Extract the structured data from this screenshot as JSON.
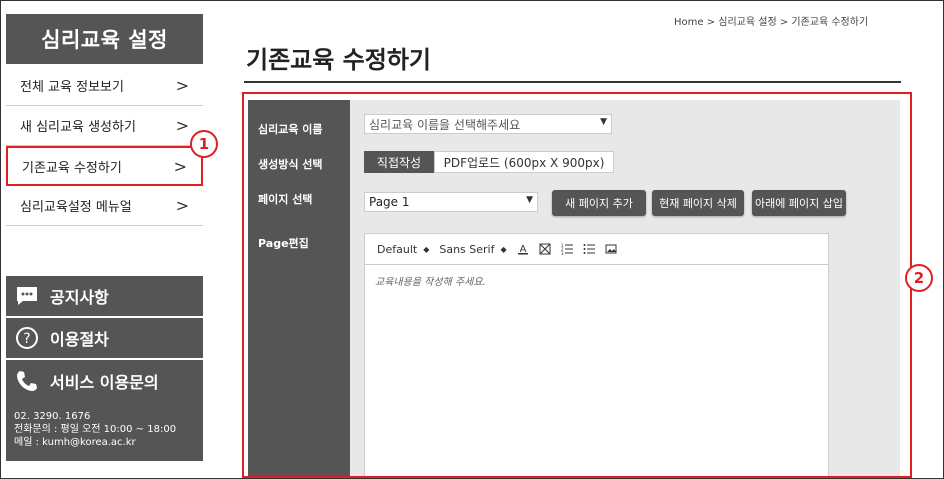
{
  "sidebar": {
    "title": "심리교육 설정",
    "items": [
      {
        "label": "전체 교육 정보보기",
        "chevron": ">"
      },
      {
        "label": "새 심리교육 생성하기",
        "chevron": ">"
      },
      {
        "label": "기존교육 수정하기",
        "chevron": ">"
      },
      {
        "label": "심리교육설정 메뉴얼",
        "chevron": ">"
      }
    ],
    "notice": {
      "label": "공지사항",
      "icon": "chat-icon"
    },
    "guide": {
      "label": "이용절차",
      "icon": "question-icon"
    },
    "contact": {
      "label": "서비스 이용문의",
      "icon": "phone-icon",
      "phone": "02. 3290. 1676",
      "hours": "전화문의 : 평일 오전 10:00 ~ 18:00",
      "email": "메일 : kumh@korea.ac.kr"
    }
  },
  "breadcrumb": "Home > 심리교육 설정 > 기존교육 수정하기",
  "page_title": "기존교육 수정하기",
  "form": {
    "name_label": "심리교육 이름",
    "name_placeholder": "심리교육 이름을 선택해주세요",
    "method_label": "생성방식 선택",
    "method_tab_direct": "직접작성",
    "method_tab_pdf": "PDF업로드 (600px X 900px)",
    "page_label": "페이지 선택",
    "page_value": "Page 1",
    "btn_add": "새 페이지 추가",
    "btn_delete": "현재 페이지 삭제",
    "btn_insert": "아래에 페이지 삽입",
    "edit_label": "Page편집",
    "editor": {
      "size": "Default",
      "font": "Sans Serif",
      "placeholder": "교육내용을 작성해 주세요."
    }
  },
  "callouts": [
    "1",
    "2"
  ],
  "colors": {
    "accent": "#e02020",
    "dark": "#555555",
    "panel": "#e8e8e8"
  }
}
